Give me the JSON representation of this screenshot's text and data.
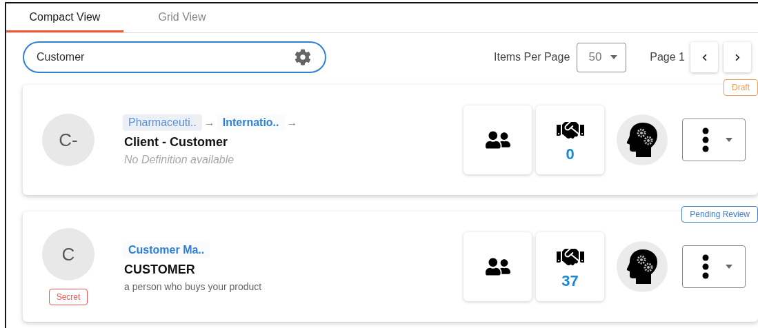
{
  "tabs": [
    {
      "label": "Compact View",
      "selected": true
    },
    {
      "label": "Grid View",
      "selected": false
    }
  ],
  "search": {
    "value": "Customer"
  },
  "pagination": {
    "items_label": "Items Per Page",
    "per_page": "50",
    "page_label": "Page 1"
  },
  "cards": [
    {
      "initials": "C-",
      "breadcrumb": [
        {
          "label": "Pharmaceuti..",
          "kind": "muted",
          "arrow": "→"
        },
        {
          "label": "Internatio..",
          "kind": "link",
          "arrow": "→"
        }
      ],
      "title": "Client - Customer",
      "definition": {
        "text": "No Definition available",
        "kind": "placeholder"
      },
      "count": "0",
      "status": {
        "label": "Draft",
        "color": "#f39a50"
      }
    },
    {
      "initials": "C",
      "classification": {
        "label": "Secret",
        "color": "#ef5350"
      },
      "breadcrumb": [
        {
          "label": "Customer Ma..",
          "kind": "link"
        }
      ],
      "title": "CUSTOMER",
      "definition": {
        "text": "a person who buys your product",
        "kind": "text"
      },
      "count": "37",
      "status": {
        "label": "Pending Review",
        "color": "#3d7cc9"
      }
    }
  ]
}
